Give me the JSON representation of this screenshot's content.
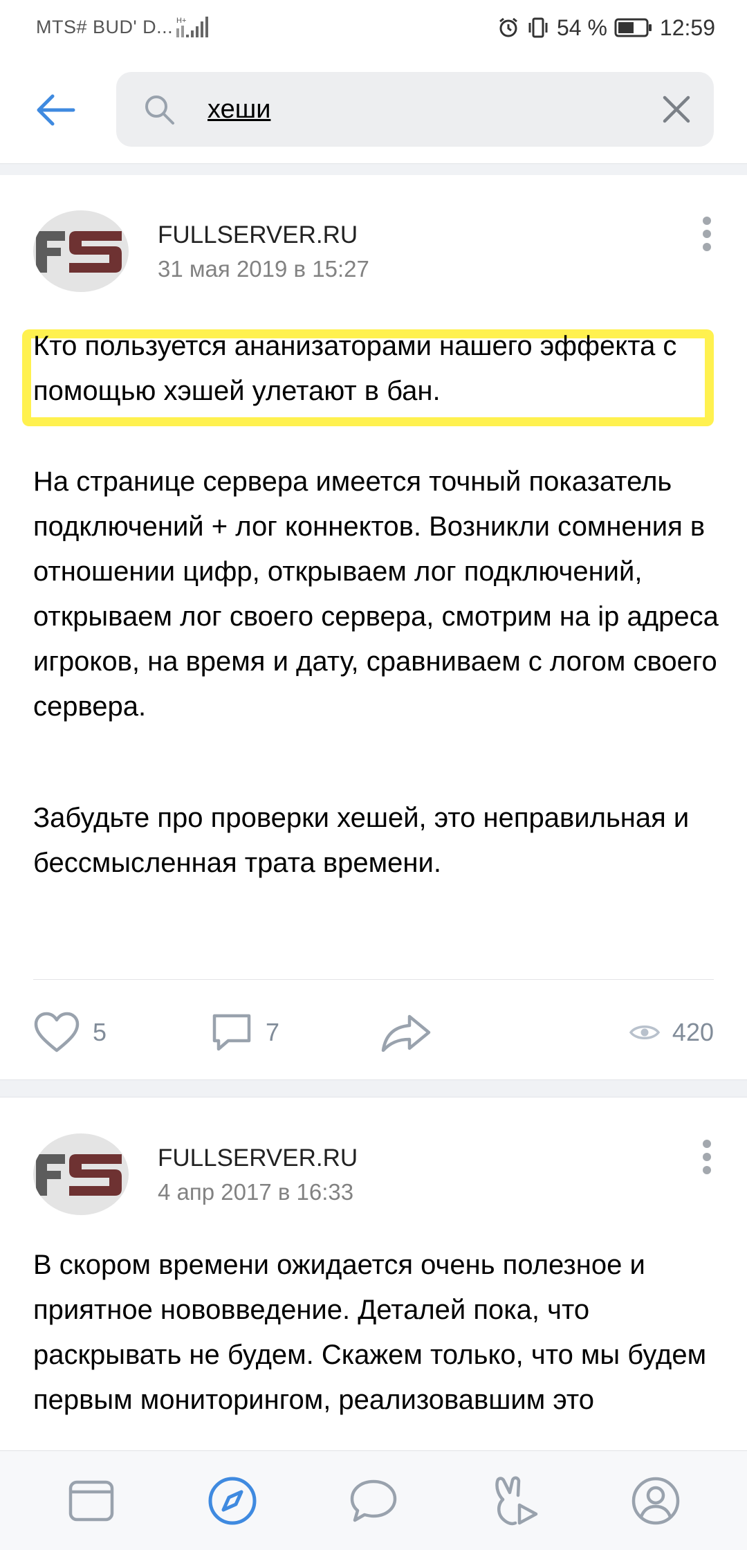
{
  "status_bar": {
    "carrier": "MTS# BUD' D...",
    "network": "H+",
    "battery": "54 %",
    "time": "12:59"
  },
  "search": {
    "query": "хеши"
  },
  "posts": [
    {
      "author": "FULLSERVER.RU",
      "date": "31 мая 2019 в 15:27",
      "highlighted_text": "Кто пользуется ананизаторами нашего эффекта с помощью хэшей улетают в бан.",
      "body_paragraphs": [
        "На странице сервера имеется точный показатель подключений + лог коннектов. Возникли сомнения в отношении цифр, открываем лог подключений, открываем лог своего сервера, смотрим на ip адреса игроков, на время и дату, сравниваем с логом своего сервера.",
        "Забудьте про проверки хешей, это неправильная и бессмысленная трата времени."
      ],
      "likes": "5",
      "comments": "7",
      "views": "420"
    },
    {
      "author": "FULLSERVER.RU",
      "date": "4 апр 2017 в 16:33",
      "body_paragraphs": [
        "В скором времени ожидается очень полезное и приятное нововведение. Деталей пока, что раскрывать не будем. Скажем только, что мы будем первым мониторингом, реализовавшим это"
      ]
    }
  ],
  "colors": {
    "accent": "#3f8ae0",
    "highlight": "#fff14f",
    "secondary_text": "#818c99",
    "avatar_f": "#5c5c5c",
    "avatar_s": "#6e3232"
  },
  "icons": {
    "back": "arrow-left-icon",
    "search": "magnifier-icon",
    "clear": "close-icon",
    "more": "vertical-dots-icon",
    "like": "heart-icon",
    "comment": "speech-bubble-icon",
    "share": "share-arrow-icon",
    "views": "eye-icon",
    "nav": [
      "newsfeed-icon",
      "explore-compass-icon",
      "messages-icon",
      "clips-icon",
      "profile-icon"
    ]
  }
}
